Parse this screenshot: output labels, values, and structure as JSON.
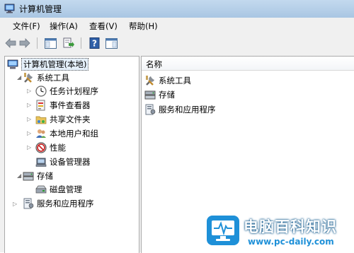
{
  "window": {
    "title": "计算机管理"
  },
  "menu": {
    "items": [
      "文件(F)",
      "操作(A)",
      "查看(V)",
      "帮助(H)"
    ]
  },
  "tree": {
    "root": "计算机管理(本地)",
    "system_tools": "系统工具",
    "task_scheduler": "任务计划程序",
    "event_viewer": "事件查看器",
    "shared_folders": "共享文件夹",
    "local_users": "本地用户和组",
    "performance": "性能",
    "device_manager": "设备管理器",
    "storage": "存储",
    "disk_management": "磁盘管理",
    "services_apps": "服务和应用程序"
  },
  "list": {
    "column_header": "名称",
    "items": [
      "系统工具",
      "存储",
      "服务和应用程序"
    ]
  },
  "watermark": {
    "title": "电脑百科知识",
    "url": "www.pc-daily.com",
    "accent": "#1e90d8"
  }
}
